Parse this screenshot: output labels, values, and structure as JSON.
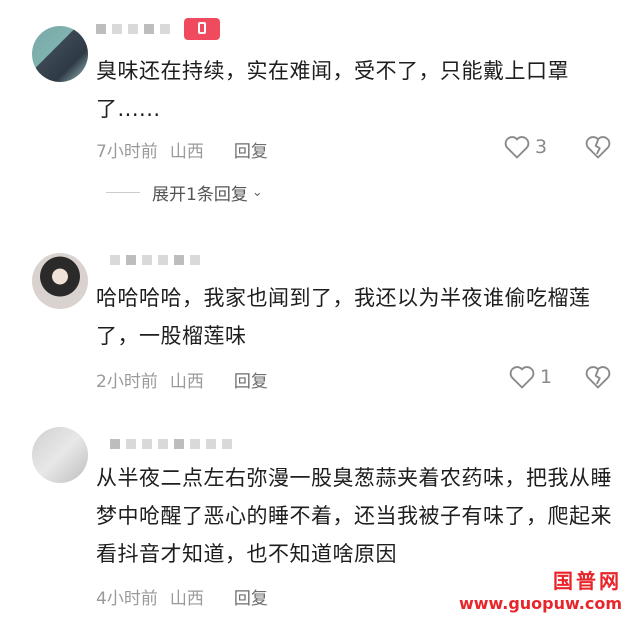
{
  "comments": [
    {
      "text": "臭味还在持续，实在难闻，受不了，只能戴上口罩了......",
      "time": "7小时前",
      "location": "山西",
      "reply_label": "回复",
      "likes": "3",
      "expand_label": "展开1条回复"
    },
    {
      "text": "哈哈哈哈，我家也闻到了，我还以为半夜谁偷吃榴莲了，一股榴莲味",
      "time": "2小时前",
      "location": "山西",
      "reply_label": "回复",
      "likes": "1"
    },
    {
      "text": "从半夜二点左右弥漫一股臭葱蒜夹着农药味，把我从睡梦中呛醒了恶心的睡不着，还当我被子有味了，爬起来看抖音才知道，也不知道啥原因",
      "time": "4小时前",
      "location": "山西",
      "reply_label": "回复"
    }
  ],
  "watermark": {
    "title": "国普网",
    "url": "www.guopuw.com"
  },
  "colors": {
    "badge": "#f04a5f",
    "watermark": "#e8252b",
    "meta_text": "#9a9a9a"
  },
  "icons": [
    "heart-outline-icon",
    "broken-heart-icon",
    "chevron-down-icon"
  ]
}
